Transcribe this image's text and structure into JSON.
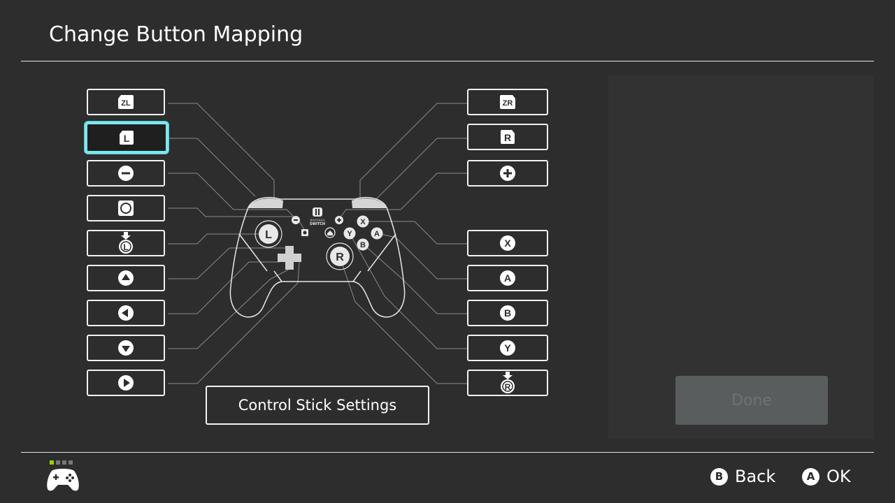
{
  "header": {
    "title": "Change Button Mapping"
  },
  "left_buttons": [
    {
      "label": "ZL",
      "icon": "zl-button-icon"
    },
    {
      "label": "L",
      "icon": "l-button-icon",
      "selected": true
    },
    {
      "label": "",
      "icon": "minus-button-icon"
    },
    {
      "label": "",
      "icon": "capture-button-icon"
    },
    {
      "label": "L",
      "icon": "left-stick-press-icon"
    },
    {
      "label": "",
      "icon": "dpad-up-icon"
    },
    {
      "label": "",
      "icon": "dpad-left-icon"
    },
    {
      "label": "",
      "icon": "dpad-down-icon"
    },
    {
      "label": "",
      "icon": "dpad-right-icon"
    }
  ],
  "right_buttons": [
    {
      "label": "ZR",
      "icon": "zr-button-icon"
    },
    {
      "label": "R",
      "icon": "r-button-icon"
    },
    {
      "label": "",
      "icon": "plus-button-icon"
    },
    {
      "label": "X",
      "icon": "x-button-icon"
    },
    {
      "label": "A",
      "icon": "a-button-icon"
    },
    {
      "label": "B",
      "icon": "b-button-icon"
    },
    {
      "label": "Y",
      "icon": "y-button-icon"
    },
    {
      "label": "R",
      "icon": "right-stick-press-icon"
    }
  ],
  "controller": {
    "brand_top": "NINTENDO",
    "brand_bottom": "SWITCH",
    "face_labels": [
      "X",
      "A",
      "B",
      "Y"
    ],
    "stick_labels": [
      "L",
      "R"
    ]
  },
  "stick_settings_label": "Control Stick Settings",
  "done_label": "Done",
  "footer": {
    "back": {
      "key": "B",
      "label": "Back"
    },
    "ok": {
      "key": "A",
      "label": "OK"
    }
  },
  "colors": {
    "selection": "#7de7ee",
    "background": "#2d2d2d",
    "player_indicator": "#9ad200"
  }
}
